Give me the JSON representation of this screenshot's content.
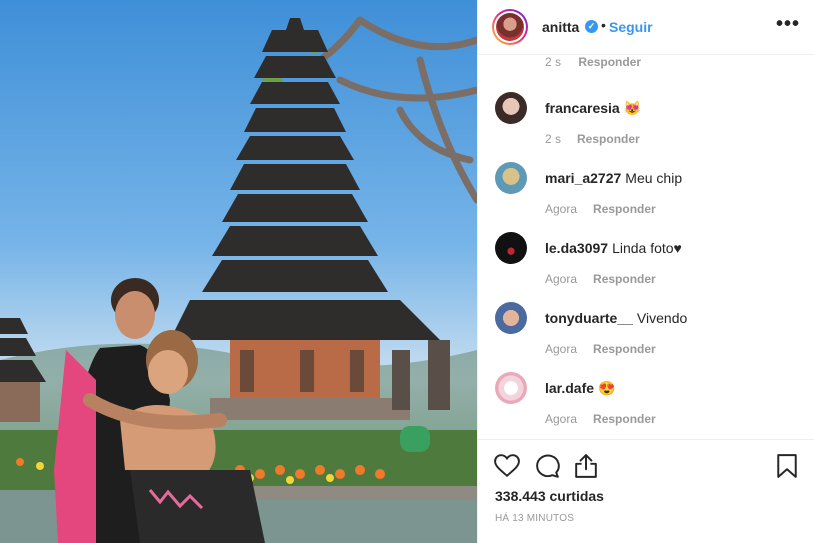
{
  "post": {
    "username": "anitta",
    "follow_label": "Seguir",
    "dot": "•",
    "more_label": "•••"
  },
  "comments": {
    "partial": {
      "time": "2 s",
      "reply": "Responder"
    },
    "items": [
      {
        "user": "francaresia",
        "text": "😻",
        "time": "2 s",
        "reply": "Responder"
      },
      {
        "user": "mari_a2727",
        "text": "Meu chip",
        "time": "Agora",
        "reply": "Responder"
      },
      {
        "user": "le.da3097",
        "text": "Linda foto♥",
        "time": "Agora",
        "reply": "Responder"
      },
      {
        "user": "tonyduarte__",
        "text": "Vivendo",
        "time": "Agora",
        "reply": "Responder"
      },
      {
        "user": "lar.dafe",
        "text": "😍",
        "time": "Agora",
        "reply": "Responder"
      }
    ]
  },
  "footer": {
    "likes": "338.443 curtidas",
    "time": "HÁ 13 MINUTOS"
  },
  "icons": [
    "heart-icon",
    "comment-icon",
    "share-icon",
    "bookmark-icon",
    "verified-badge-icon",
    "more-options-icon"
  ]
}
